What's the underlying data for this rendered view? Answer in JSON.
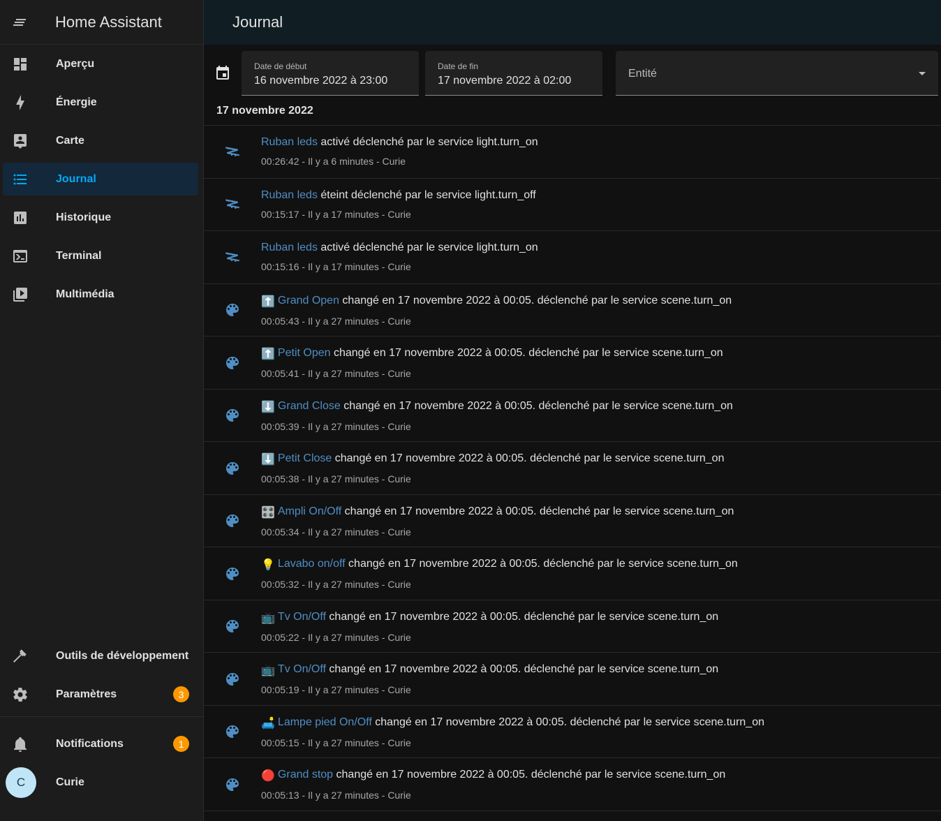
{
  "app": {
    "title": "Home Assistant"
  },
  "sidebar": {
    "items": [
      {
        "label": "Aperçu",
        "icon": "dashboard-icon",
        "active": false
      },
      {
        "label": "Énergie",
        "icon": "lightning-icon",
        "active": false
      },
      {
        "label": "Carte",
        "icon": "map-marker-icon",
        "active": false
      },
      {
        "label": "Journal",
        "icon": "list-icon",
        "active": true
      },
      {
        "label": "Historique",
        "icon": "chart-bar-icon",
        "active": false
      },
      {
        "label": "Terminal",
        "icon": "console-icon",
        "active": false
      },
      {
        "label": "Multimédia",
        "icon": "play-box-icon",
        "active": false
      }
    ],
    "dev_tools": {
      "label": "Outils de développement",
      "icon": "hammer-icon"
    },
    "settings": {
      "label": "Paramètres",
      "icon": "gear-icon",
      "badge": "3"
    },
    "notifications": {
      "label": "Notifications",
      "icon": "bell-icon",
      "badge": "1"
    },
    "user": {
      "initial": "C",
      "name": "Curie"
    }
  },
  "header": {
    "title": "Journal"
  },
  "filters": {
    "start": {
      "label": "Date de début",
      "value": "16 novembre 2022 à 23:00"
    },
    "end": {
      "label": "Date de fin",
      "value": "17 novembre 2022 à 02:00"
    },
    "entity": {
      "placeholder": "Entité"
    }
  },
  "day_heading": "17 novembre 2022",
  "colors": {
    "accent": "#03a9f4",
    "entity_link": "#4f8ec4",
    "badge": "#ff9800"
  },
  "entries": [
    {
      "icon": "led-strip-icon",
      "emoji": "",
      "entity": "Ruban leds",
      "text": " activé déclenché par le service light.turn_on",
      "meta": "00:26:42 - Il y a 6 minutes - Curie"
    },
    {
      "icon": "led-strip-icon",
      "emoji": "",
      "entity": "Ruban leds",
      "text": " éteint déclenché par le service light.turn_off",
      "meta": "00:15:17 - Il y a 17 minutes - Curie"
    },
    {
      "icon": "led-strip-icon",
      "emoji": "",
      "entity": "Ruban leds",
      "text": " activé déclenché par le service light.turn_on",
      "meta": "00:15:16 - Il y a 17 minutes - Curie"
    },
    {
      "icon": "palette-icon",
      "emoji": "⬆️",
      "entity": "Grand Open",
      "text": " changé en 17 novembre 2022 à 00:05. déclenché par le service scene.turn_on",
      "meta": "00:05:43 - Il y a 27 minutes - Curie"
    },
    {
      "icon": "palette-icon",
      "emoji": "⬆️",
      "entity": "Petit Open",
      "text": " changé en 17 novembre 2022 à 00:05. déclenché par le service scene.turn_on",
      "meta": "00:05:41 - Il y a 27 minutes - Curie"
    },
    {
      "icon": "palette-icon",
      "emoji": "⬇️",
      "entity": "Grand Close",
      "text": " changé en 17 novembre 2022 à 00:05. déclenché par le service scene.turn_on",
      "meta": "00:05:39 - Il y a 27 minutes - Curie"
    },
    {
      "icon": "palette-icon",
      "emoji": "⬇️",
      "entity": "Petit Close",
      "text": " changé en 17 novembre 2022 à 00:05. déclenché par le service scene.turn_on",
      "meta": "00:05:38 - Il y a 27 minutes - Curie"
    },
    {
      "icon": "palette-icon",
      "emoji": "🎛️",
      "entity": "Ampli On/Off",
      "text": " changé en 17 novembre 2022 à 00:05. déclenché par le service scene.turn_on",
      "meta": "00:05:34 - Il y a 27 minutes - Curie"
    },
    {
      "icon": "palette-icon",
      "emoji": "💡",
      "entity": "Lavabo on/off",
      "text": " changé en 17 novembre 2022 à 00:05. déclenché par le service scene.turn_on",
      "meta": "00:05:32 - Il y a 27 minutes - Curie"
    },
    {
      "icon": "palette-icon",
      "emoji": "📺",
      "entity": "Tv On/Off",
      "text": " changé en 17 novembre 2022 à 00:05. déclenché par le service scene.turn_on",
      "meta": "00:05:22 - Il y a 27 minutes - Curie"
    },
    {
      "icon": "palette-icon",
      "emoji": "📺",
      "entity": "Tv On/Off",
      "text": " changé en 17 novembre 2022 à 00:05. déclenché par le service scene.turn_on",
      "meta": "00:05:19 - Il y a 27 minutes - Curie"
    },
    {
      "icon": "palette-icon",
      "emoji": "🛋️",
      "entity": "Lampe pied On/Off",
      "text": " changé en 17 novembre 2022 à 00:05. déclenché par le service scene.turn_on",
      "meta": "00:05:15 - Il y a 27 minutes - Curie"
    },
    {
      "icon": "palette-icon",
      "emoji": "🔴",
      "entity": "Grand stop",
      "text": " changé en 17 novembre 2022 à 00:05. déclenché par le service scene.turn_on",
      "meta": "00:05:13 - Il y a 27 minutes - Curie"
    }
  ]
}
